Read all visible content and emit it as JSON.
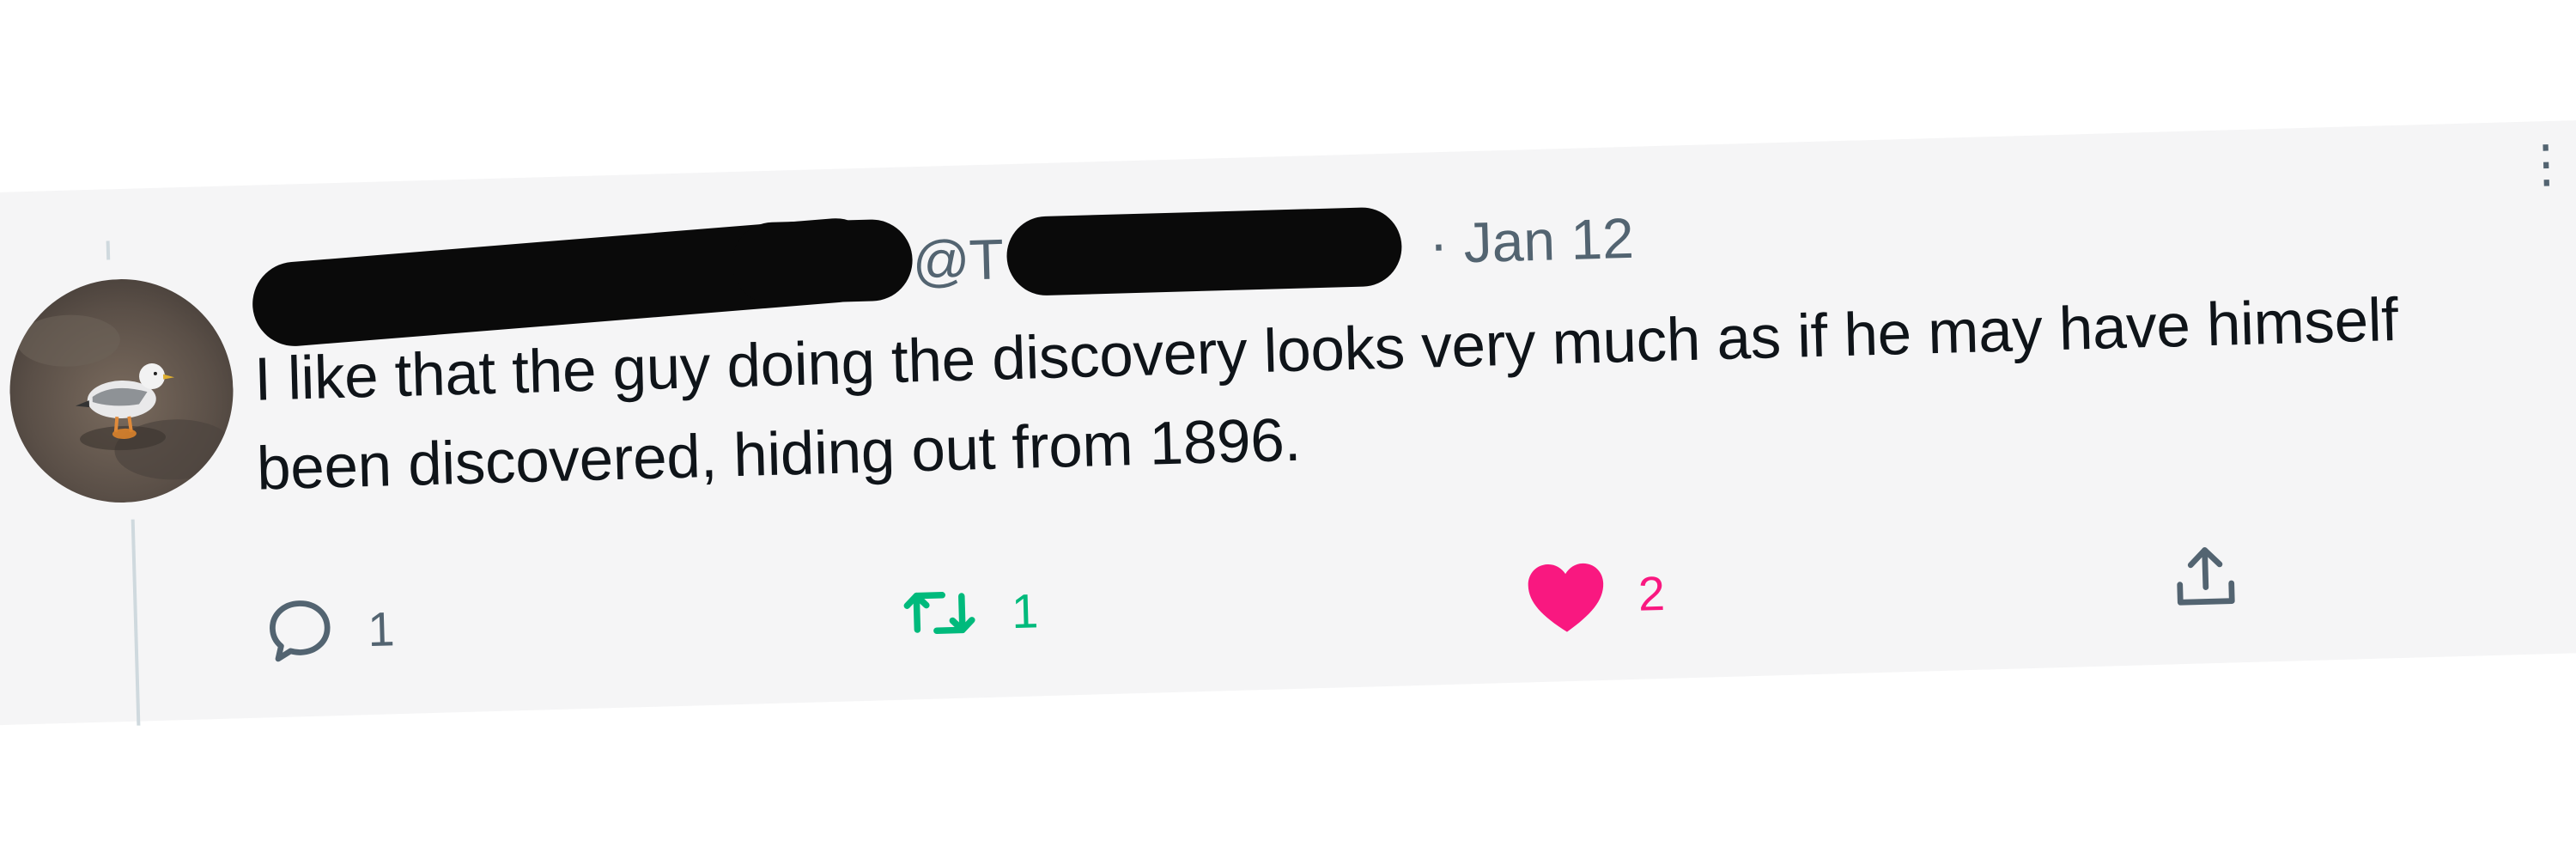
{
  "tweet": {
    "handle_prefix": "@T",
    "date_separator": "·",
    "date": "Jan 12",
    "text": "I like that the guy doing the discovery looks very much as if he may have himself been discovered, hiding out from 1896."
  },
  "actions": {
    "reply": {
      "icon": "reply-icon",
      "count": "1"
    },
    "retweet": {
      "icon": "retweet-icon",
      "count": "1",
      "active": true,
      "color": "#00ba7c"
    },
    "like": {
      "icon": "heart-icon",
      "count": "2",
      "active": true,
      "color": "#f91880"
    },
    "share": {
      "icon": "share-icon"
    }
  },
  "colors": {
    "secondary_text": "#536471",
    "primary_text": "#0f1419",
    "card_background": "#f5f5f6"
  }
}
